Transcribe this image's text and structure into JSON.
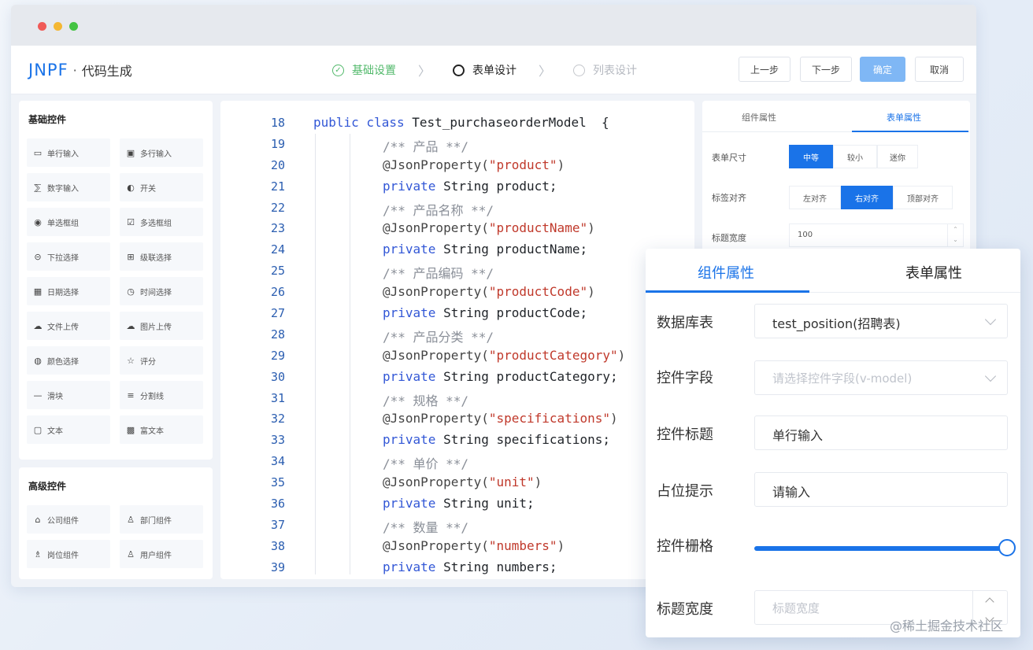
{
  "window": {
    "brand_logo": "JNPF",
    "brand_sep": "·",
    "brand_title": "代码生成"
  },
  "steps": [
    {
      "label": "基础设置",
      "state": "done"
    },
    {
      "label": "表单设计",
      "state": "active"
    },
    {
      "label": "列表设计",
      "state": "todo"
    }
  ],
  "header_buttons": {
    "prev": "上一步",
    "next": "下一步",
    "confirm": "确定",
    "cancel": "取消"
  },
  "palette_basic": {
    "title": "基础控件",
    "items": [
      {
        "label": "单行输入",
        "icon": "input-icon"
      },
      {
        "label": "多行输入",
        "icon": "textarea-icon"
      },
      {
        "label": "数字输入",
        "icon": "number-icon"
      },
      {
        "label": "开关",
        "icon": "switch-icon"
      },
      {
        "label": "单选框组",
        "icon": "radio-icon"
      },
      {
        "label": "多选框组",
        "icon": "checkbox-icon"
      },
      {
        "label": "下拉选择",
        "icon": "select-icon"
      },
      {
        "label": "级联选择",
        "icon": "cascader-icon"
      },
      {
        "label": "日期选择",
        "icon": "date-icon"
      },
      {
        "label": "时间选择",
        "icon": "time-icon"
      },
      {
        "label": "文件上传",
        "icon": "upload-icon"
      },
      {
        "label": "图片上传",
        "icon": "image-upload-icon"
      },
      {
        "label": "颜色选择",
        "icon": "color-icon"
      },
      {
        "label": "评分",
        "icon": "star-icon"
      },
      {
        "label": "滑块",
        "icon": "slider-icon"
      },
      {
        "label": "分割线",
        "icon": "divider-icon"
      },
      {
        "label": "文本",
        "icon": "text-icon"
      },
      {
        "label": "富文本",
        "icon": "richtext-icon"
      }
    ]
  },
  "palette_advanced": {
    "title": "高级控件",
    "items": [
      {
        "label": "公司组件",
        "icon": "company-icon"
      },
      {
        "label": "部门组件",
        "icon": "department-icon"
      },
      {
        "label": "岗位组件",
        "icon": "position-icon"
      },
      {
        "label": "用户组件",
        "icon": "user-icon"
      }
    ]
  },
  "code": {
    "lines": [
      {
        "n": "18",
        "indent": 0,
        "tokens": [
          [
            "kw",
            "public class "
          ],
          [
            "tx",
            "Test_purchaseorderModel  {"
          ]
        ]
      },
      {
        "n": "19",
        "indent": 1,
        "tokens": [
          [
            "cm",
            "/** 产品 **/"
          ]
        ]
      },
      {
        "n": "20",
        "indent": 1,
        "tokens": [
          [
            "an",
            "@JsonProperty("
          ],
          [
            "st",
            "\"product\""
          ],
          [
            "an",
            ")"
          ]
        ]
      },
      {
        "n": "21",
        "indent": 1,
        "tokens": [
          [
            "kw",
            "private "
          ],
          [
            "tx",
            "String product;"
          ]
        ]
      },
      {
        "n": "22",
        "indent": 1,
        "tokens": [
          [
            "cm",
            "/** 产品名称 **/"
          ]
        ]
      },
      {
        "n": "23",
        "indent": 1,
        "tokens": [
          [
            "an",
            "@JsonProperty("
          ],
          [
            "st",
            "\"productName\""
          ],
          [
            "an",
            ")"
          ]
        ]
      },
      {
        "n": "24",
        "indent": 1,
        "tokens": [
          [
            "kw",
            "private "
          ],
          [
            "tx",
            "String productName;"
          ]
        ]
      },
      {
        "n": "25",
        "indent": 1,
        "tokens": [
          [
            "cm",
            "/** 产品编码 **/"
          ]
        ]
      },
      {
        "n": "26",
        "indent": 1,
        "tokens": [
          [
            "an",
            "@JsonProperty("
          ],
          [
            "st",
            "\"productCode\""
          ],
          [
            "an",
            ")"
          ]
        ]
      },
      {
        "n": "27",
        "indent": 1,
        "tokens": [
          [
            "kw",
            "private "
          ],
          [
            "tx",
            "String productCode;"
          ]
        ]
      },
      {
        "n": "28",
        "indent": 1,
        "tokens": [
          [
            "cm",
            "/** 产品分类 **/"
          ]
        ]
      },
      {
        "n": "29",
        "indent": 1,
        "tokens": [
          [
            "an",
            "@JsonProperty("
          ],
          [
            "st",
            "\"productCategory\""
          ],
          [
            "an",
            ")"
          ]
        ]
      },
      {
        "n": "30",
        "indent": 1,
        "tokens": [
          [
            "kw",
            "private "
          ],
          [
            "tx",
            "String productCategory;"
          ]
        ]
      },
      {
        "n": "31",
        "indent": 1,
        "tokens": [
          [
            "cm",
            "/** 规格 **/"
          ]
        ]
      },
      {
        "n": "32",
        "indent": 1,
        "tokens": [
          [
            "an",
            "@JsonProperty("
          ],
          [
            "st",
            "\"specifications\""
          ],
          [
            "an",
            ")"
          ]
        ]
      },
      {
        "n": "33",
        "indent": 1,
        "tokens": [
          [
            "kw",
            "private "
          ],
          [
            "tx",
            "String specifications;"
          ]
        ]
      },
      {
        "n": "34",
        "indent": 1,
        "tokens": [
          [
            "cm",
            "/** 单价 **/"
          ]
        ]
      },
      {
        "n": "35",
        "indent": 1,
        "tokens": [
          [
            "an",
            "@JsonProperty("
          ],
          [
            "st",
            "\"unit\""
          ],
          [
            "an",
            ")"
          ]
        ]
      },
      {
        "n": "36",
        "indent": 1,
        "tokens": [
          [
            "kw",
            "private "
          ],
          [
            "tx",
            "String unit;"
          ]
        ]
      },
      {
        "n": "37",
        "indent": 1,
        "tokens": [
          [
            "cm",
            "/** 数量 **/"
          ]
        ]
      },
      {
        "n": "38",
        "indent": 1,
        "tokens": [
          [
            "an",
            "@JsonProperty("
          ],
          [
            "st",
            "\"numbers\""
          ],
          [
            "an",
            ")"
          ]
        ]
      },
      {
        "n": "39",
        "indent": 1,
        "tokens": [
          [
            "kw",
            "private "
          ],
          [
            "tx",
            "String numbers;"
          ]
        ]
      }
    ]
  },
  "props_back": {
    "tab_component": "组件属性",
    "tab_form": "表单属性",
    "size_label": "表单尺寸",
    "size_options": [
      "中等",
      "较小",
      "迷你"
    ],
    "size_selected": "中等",
    "align_label": "标签对齐",
    "align_options": [
      "左对齐",
      "右对齐",
      "顶部对齐"
    ],
    "align_selected": "右对齐",
    "width_label": "标题宽度",
    "width_value": "100",
    "spin_up": "⌃",
    "spin_down": "⌄"
  },
  "props_front": {
    "tab_component": "组件属性",
    "tab_form": "表单属性",
    "db_label": "数据库表",
    "db_value": "test_position(招聘表)",
    "field_label": "控件字段",
    "field_placeholder": "请选择控件字段(v-model)",
    "title_label": "控件标题",
    "title_value": "单行输入",
    "placeholder_label": "占位提示",
    "placeholder_value": "请输入",
    "grid_label": "控件栅格",
    "grid_value_fraction": 1.0,
    "width_label": "标题宽度",
    "width_placeholder": "标题宽度"
  },
  "watermark": "@稀土掘金技术社区",
  "colors": {
    "accent": "#1a73e8",
    "done_green": "#52b96b",
    "string_red": "#c0392b",
    "keyword_blue": "#3257d6"
  }
}
